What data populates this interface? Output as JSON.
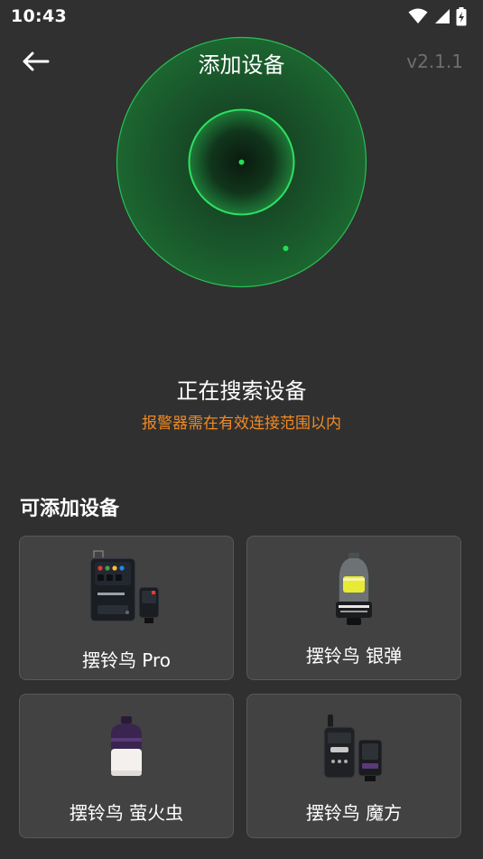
{
  "status_bar": {
    "time": "10:43"
  },
  "header": {
    "title": "添加设备",
    "version": "v2.1.1"
  },
  "search": {
    "title": "正在搜索设备",
    "hint": "报警器需在有效连接范围以内"
  },
  "devices": {
    "section_title": "可添加设备",
    "items": [
      {
        "label": "摆铃鸟 Pro"
      },
      {
        "label": "摆铃鸟 银弹"
      },
      {
        "label": "摆铃鸟 萤火虫"
      },
      {
        "label": "摆铃鸟 魔方"
      }
    ]
  },
  "colors": {
    "background": "#303030",
    "card": "#424242",
    "radar_green": "#22dd55",
    "hint_orange": "#f08a24",
    "version_gray": "#6e6e6e"
  }
}
